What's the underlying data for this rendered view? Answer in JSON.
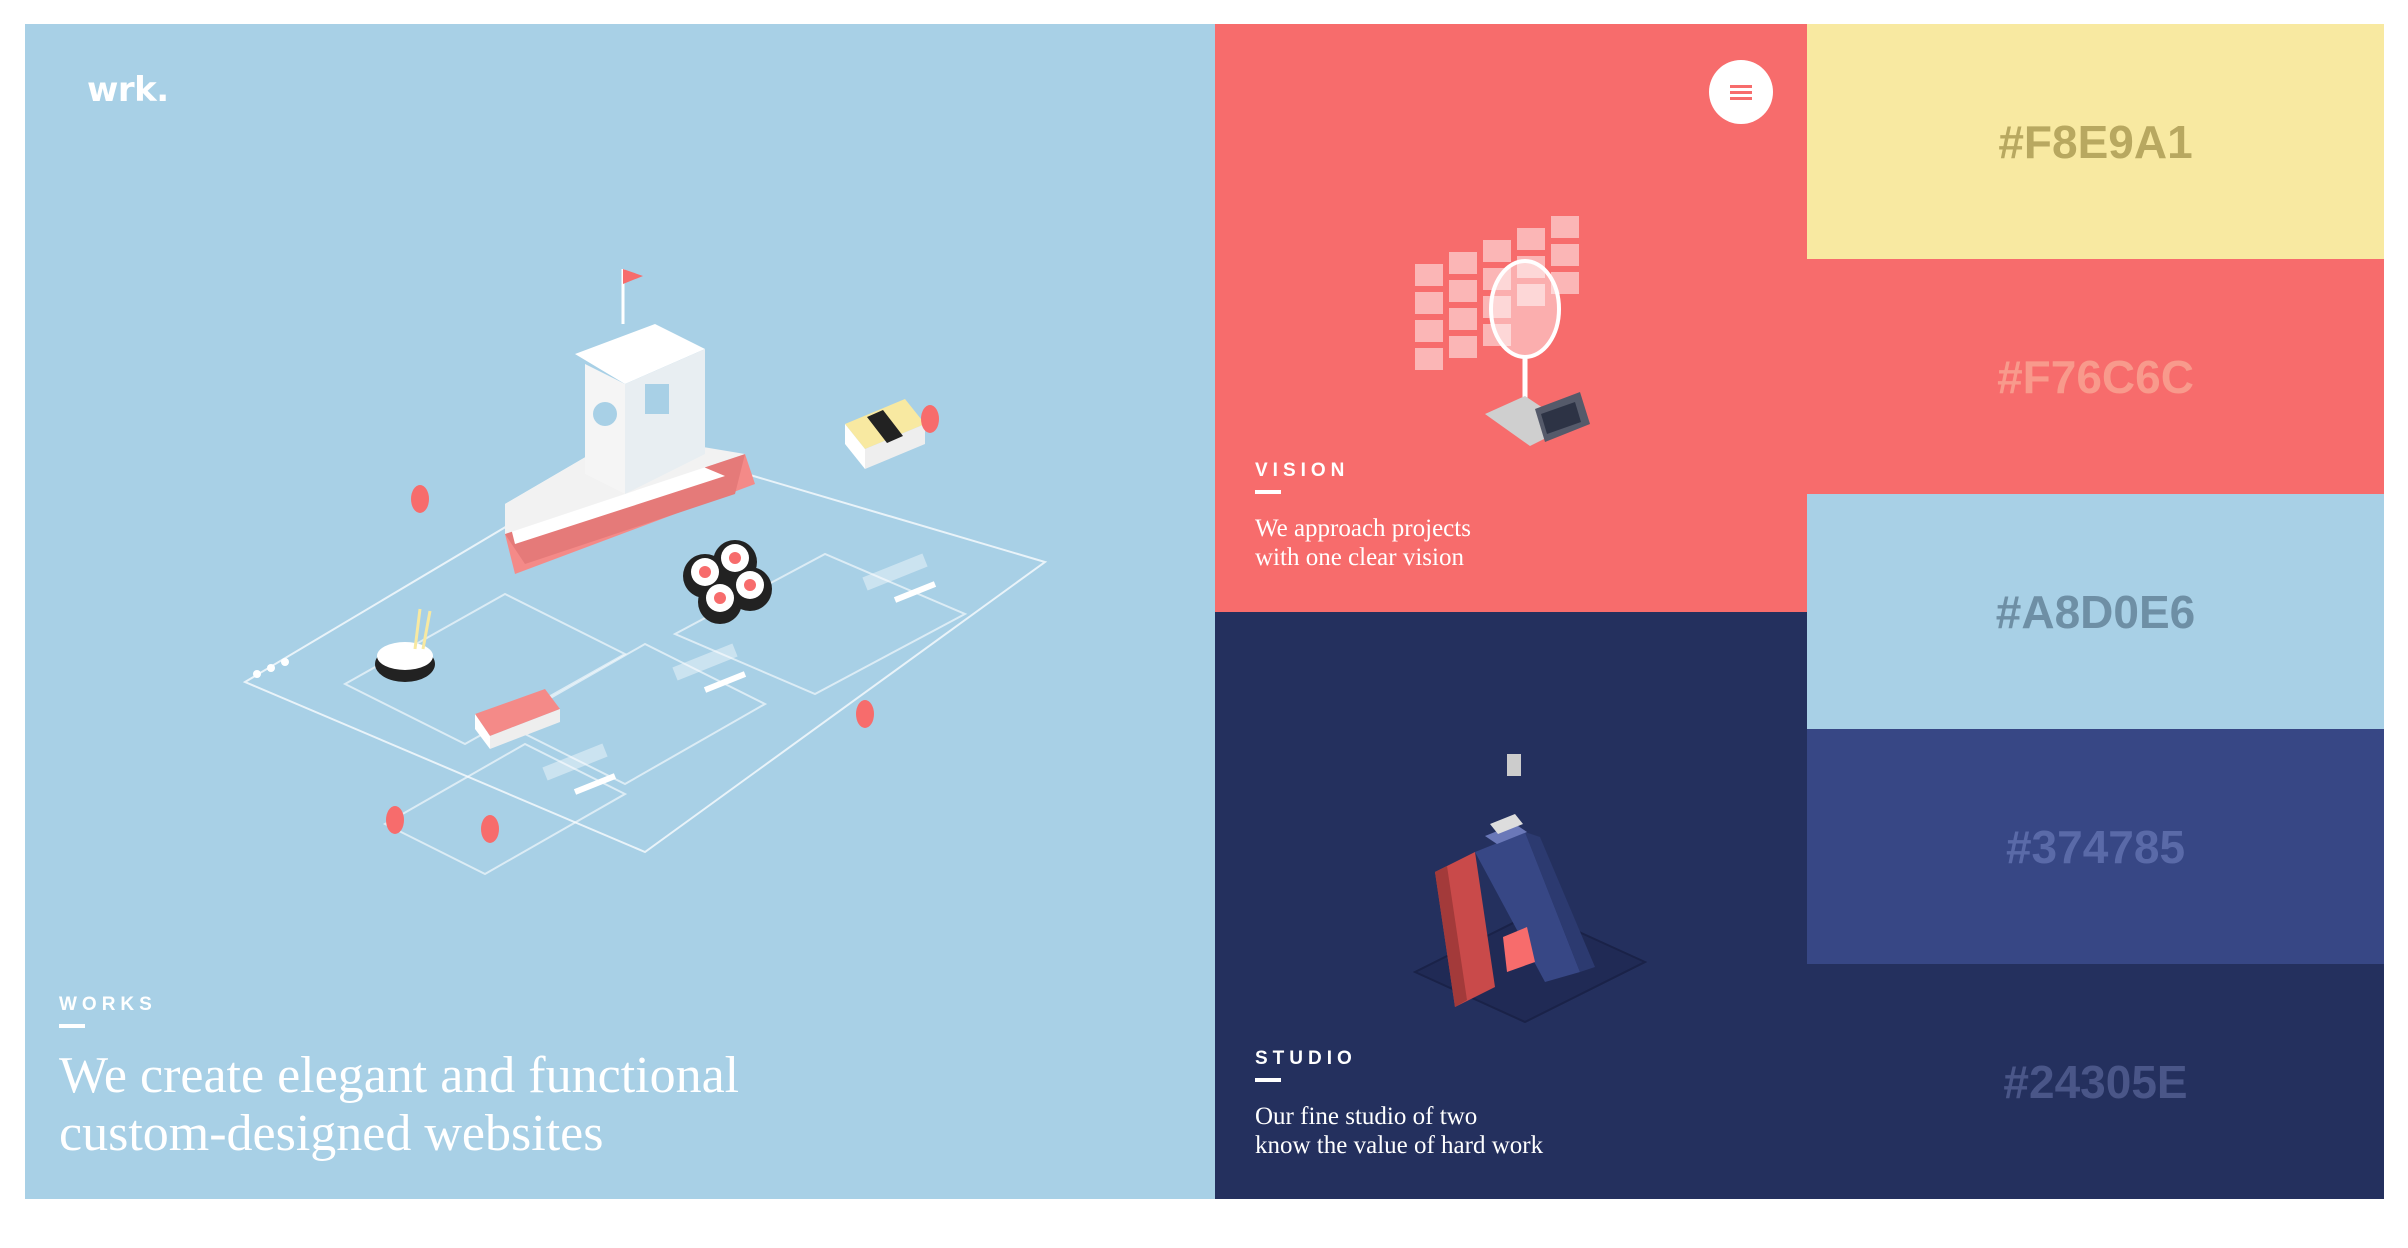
{
  "logo": "wrk.",
  "works": {
    "label": "WORKS",
    "headline_lines": [
      "We create elegant and functional",
      "custom-designed websites"
    ]
  },
  "vision": {
    "label": "VISION",
    "text_lines": [
      "We approach projects",
      "with one clear vision"
    ],
    "menu_icon": "hamburger-icon"
  },
  "studio": {
    "label": "STUDIO",
    "text_lines": [
      "Our fine studio of two",
      "know the value of hard work"
    ]
  },
  "swatches": [
    {
      "label": "#F8E9A1",
      "color": "#F8E9A1",
      "text_color": "#B8A860"
    },
    {
      "label": "#F76C6C",
      "color": "#F76C6C",
      "text_color": "#F89A8C"
    },
    {
      "label": "#A8D0E6",
      "color": "#A8D0E6",
      "text_color": "#6E8FA5"
    },
    {
      "label": "#374785",
      "color": "#374785",
      "text_color": "#5A6AA8"
    },
    {
      "label": "#24305E",
      "color": "#24305E",
      "text_color": "#4A5688"
    }
  ]
}
